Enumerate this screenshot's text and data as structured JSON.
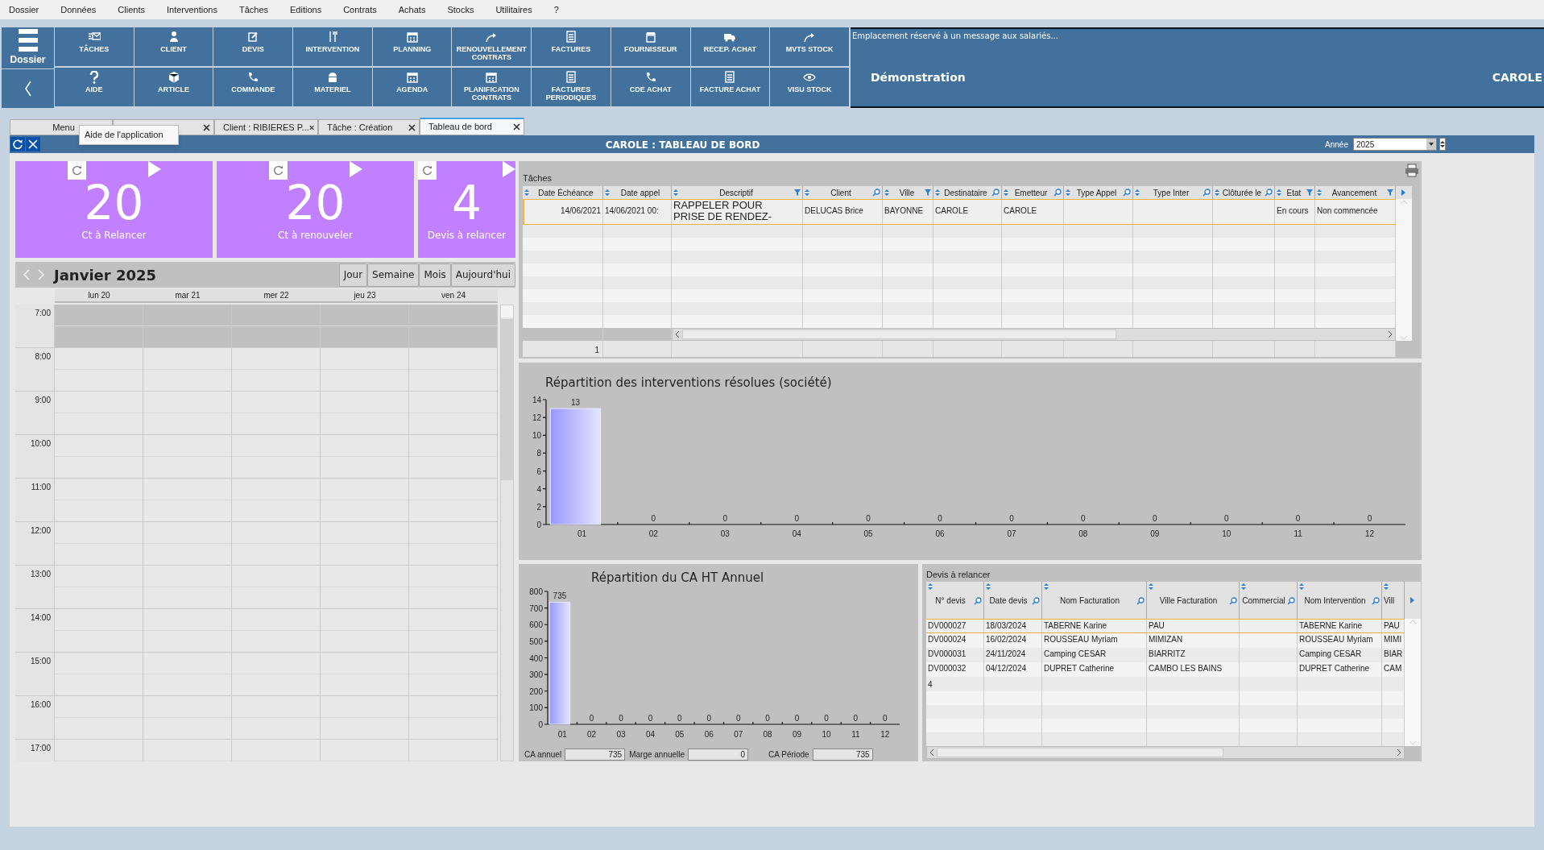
{
  "menu_bar": [
    "Dossier",
    "Données",
    "Clients",
    "Interventions",
    "Tâches",
    "Editions",
    "Contrats",
    "Achats",
    "Stocks",
    "Utilitaires",
    "?"
  ],
  "toolbar": {
    "side_button": "Dossier",
    "buttons": [
      "TÂCHES",
      "CLIENT",
      "DEVIS",
      "INTERVENTION",
      "PLANNING",
      "RENOUVELLEMENT CONTRATS",
      "FACTURES",
      "FOURNISSEUR",
      "RECEP. ACHAT",
      "MVTS STOCK",
      "AIDE",
      "ARTICLE",
      "COMMANDE",
      "MATERIEL",
      "AGENDA",
      "PLANIFICATION CONTRATS",
      "FACTURES PERIODIQUES",
      "CDE ACHAT",
      "FACTURE ACHAT",
      "VISU STOCK"
    ]
  },
  "message_panel": {
    "message": "Emplacement réservé à un  message aux salariés...",
    "company": "Démonstration",
    "user": "CAROLE"
  },
  "tabs": [
    {
      "label": "Menu",
      "selected": false,
      "closable": false
    },
    {
      "selected": false,
      "closable": true
    },
    {
      "label": "Client : RIBIERES P...",
      "selected": false,
      "closable": true
    },
    {
      "label": "Tâche : Création",
      "selected": false,
      "closable": true
    },
    {
      "label": "Tableau de bord",
      "selected": true,
      "closable": true
    }
  ],
  "tooltip": "Aide de l'application",
  "title_bar": {
    "title": "CAROLE : TABLEAU DE BORD",
    "year_label": "Année",
    "year": "2025"
  },
  "tiles": [
    {
      "value": "20",
      "label": "Ct à Relancer"
    },
    {
      "value": "20",
      "label": "Ct à renouveler"
    },
    {
      "value": "4",
      "label": "Devis à relancer"
    }
  ],
  "calendar": {
    "title": "Janvier 2025",
    "views": [
      "Jour",
      "Semaine",
      "Mois",
      "Aujourd'hui"
    ],
    "days": [
      "lun 20",
      "mar 21",
      "mer 22",
      "jeu 23",
      "ven 24"
    ],
    "hours": [
      {
        "label": "7:00",
        "off_hours": true
      },
      {
        "label": "8:00",
        "off_hours": false
      },
      {
        "label": "9:00",
        "off_hours": false
      },
      {
        "label": "10:00",
        "off_hours": false
      },
      {
        "label": "11:00",
        "off_hours": false
      },
      {
        "label": "12:00",
        "off_hours": false
      },
      {
        "label": "13:00",
        "off_hours": false
      },
      {
        "label": "14:00",
        "off_hours": false
      },
      {
        "label": "15:00",
        "off_hours": false
      },
      {
        "label": "16:00",
        "off_hours": false
      },
      {
        "label": "17:00",
        "off_hours": false
      }
    ]
  },
  "tasks": {
    "title": "Tâches",
    "columns": [
      "Date Échéance",
      "Date appel",
      "Descriptif",
      "Client",
      "Ville",
      "Destinataire",
      "Emetteur",
      "Type Appel",
      "Type Inter",
      "Clôturée le",
      "Etat",
      "Avancement"
    ],
    "rows": [
      {
        "selected": true,
        "cells": [
          "14/06/2021",
          "14/06/2021 00:",
          "RAPPELER POUR PRISE DE RENDEZ-",
          "DELUCAS Brice",
          "BAYONNE",
          "CAROLE",
          "CAROLE",
          "",
          "",
          "",
          "En cours",
          "Non commencée"
        ]
      }
    ],
    "count": "1"
  },
  "interventions_chart": {
    "chart_data": {
      "type": "bar",
      "title": "Répartition des interventions résolues (société)",
      "categories": [
        "01",
        "02",
        "03",
        "04",
        "05",
        "06",
        "07",
        "08",
        "09",
        "10",
        "11",
        "12"
      ],
      "values": [
        13,
        0,
        0,
        0,
        0,
        0,
        0,
        0,
        0,
        0,
        0,
        0
      ],
      "ylim": [
        0,
        14
      ],
      "yticks": [
        0,
        2,
        4,
        6,
        8,
        10,
        12,
        14
      ],
      "data_labels": true
    }
  },
  "revenue_chart": {
    "chart_data": {
      "type": "bar",
      "title": "Répartition du CA HT Annuel",
      "categories": [
        "01",
        "02",
        "03",
        "04",
        "05",
        "06",
        "07",
        "08",
        "09",
        "10",
        "11",
        "12"
      ],
      "values": [
        735,
        0,
        0,
        0,
        0,
        0,
        0,
        0,
        0,
        0,
        0,
        0
      ],
      "ylim": [
        0,
        800
      ],
      "yticks": [
        0,
        100,
        200,
        300,
        400,
        500,
        600,
        700,
        800
      ],
      "data_labels": true
    },
    "fields": [
      {
        "label": "CA annuel",
        "value": "735"
      },
      {
        "label": "Marge annuelle",
        "value": "0"
      },
      {
        "label": "CA Période",
        "value": "735"
      }
    ]
  },
  "quotes": {
    "title": "Devis à relancer",
    "columns": [
      "N° devis",
      "Date devis",
      "Nom Facturation",
      "Ville Facturation",
      "Commercial",
      "Nom Intervention",
      "Vill"
    ],
    "rows": [
      {
        "selected": true,
        "cells": [
          "DV000027",
          "18/03/2024",
          "TABERNE Karine",
          "PAU",
          "",
          "TABERNE Karine",
          "PAU"
        ]
      },
      {
        "selected": false,
        "cells": [
          "DV000024",
          "16/02/2024",
          "ROUSSEAU Myriam",
          "MIMIZAN",
          "",
          "ROUSSEAU Myriam",
          "MIMI"
        ]
      },
      {
        "selected": false,
        "cells": [
          "DV000031",
          "24/11/2024",
          "Camping CESAR",
          "BIARRITZ",
          "",
          "Camping CESAR",
          "BIAR"
        ]
      },
      {
        "selected": false,
        "cells": [
          "DV000032",
          "04/12/2024",
          "DUPRET Catherine",
          "CAMBO LES BAINS",
          "",
          "DUPRET Catherine",
          "CAM"
        ]
      }
    ],
    "count": "4"
  }
}
